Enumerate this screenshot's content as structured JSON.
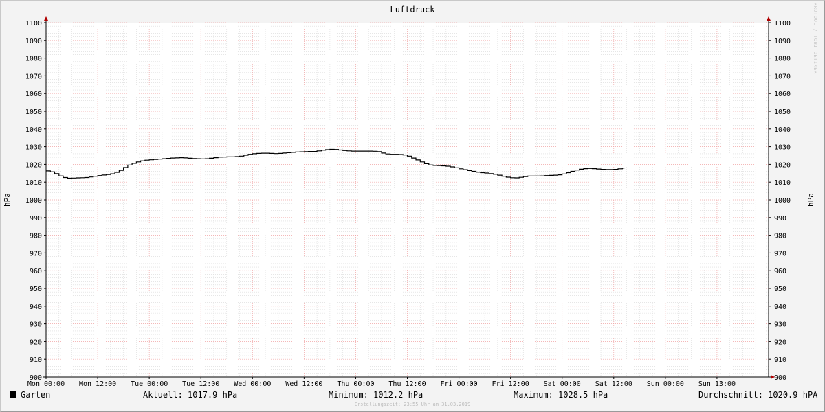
{
  "chart_data": {
    "type": "line",
    "title": "Luftdruck",
    "ylabel": "hPa",
    "ylabel_right": "hPa",
    "ylim": [
      900,
      1100
    ],
    "yticks": [
      900,
      910,
      920,
      930,
      940,
      950,
      960,
      970,
      980,
      990,
      1000,
      1010,
      1020,
      1030,
      1040,
      1050,
      1060,
      1070,
      1080,
      1090,
      1100
    ],
    "xticks": [
      {
        "h": 0,
        "label": "Mon 00:00"
      },
      {
        "h": 12,
        "label": "Mon 12:00"
      },
      {
        "h": 24,
        "label": "Tue 00:00"
      },
      {
        "h": 36,
        "label": "Tue 12:00"
      },
      {
        "h": 48,
        "label": "Wed 00:00"
      },
      {
        "h": 60,
        "label": "Wed 12:00"
      },
      {
        "h": 72,
        "label": "Thu 00:00"
      },
      {
        "h": 84,
        "label": "Thu 12:00"
      },
      {
        "h": 96,
        "label": "Fri 00:00"
      },
      {
        "h": 108,
        "label": "Fri 12:00"
      },
      {
        "h": 120,
        "label": "Sat 00:00"
      },
      {
        "h": 132,
        "label": "Sat 12:00"
      },
      {
        "h": 144,
        "label": "Sun 00:00"
      },
      {
        "h": 156,
        "label": "Sun 13:00"
      }
    ],
    "xlim": [
      0,
      168
    ],
    "grid": true,
    "series": [
      {
        "name": "Garten",
        "color": "#000000",
        "points": [
          [
            0,
            1016.3
          ],
          [
            1,
            1015.8
          ],
          [
            2,
            1014.8
          ],
          [
            3,
            1013.5
          ],
          [
            4,
            1012.6
          ],
          [
            5,
            1012.2
          ],
          [
            6,
            1012.3
          ],
          [
            7,
            1012.4
          ],
          [
            8,
            1012.5
          ],
          [
            9,
            1012.6
          ],
          [
            10,
            1012.9
          ],
          [
            11,
            1013.3
          ],
          [
            12,
            1013.7
          ],
          [
            13,
            1014.0
          ],
          [
            14,
            1014.3
          ],
          [
            15,
            1014.7
          ],
          [
            16,
            1015.5
          ],
          [
            17,
            1016.6
          ],
          [
            18,
            1018.2
          ],
          [
            19,
            1019.6
          ],
          [
            20,
            1020.6
          ],
          [
            21,
            1021.4
          ],
          [
            22,
            1022.0
          ],
          [
            23,
            1022.4
          ],
          [
            24,
            1022.6
          ],
          [
            25,
            1022.8
          ],
          [
            26,
            1023.0
          ],
          [
            27,
            1023.2
          ],
          [
            28,
            1023.4
          ],
          [
            29,
            1023.6
          ],
          [
            30,
            1023.7
          ],
          [
            31,
            1023.8
          ],
          [
            32,
            1023.7
          ],
          [
            33,
            1023.5
          ],
          [
            34,
            1023.3
          ],
          [
            35,
            1023.2
          ],
          [
            36,
            1023.1
          ],
          [
            37,
            1023.2
          ],
          [
            38,
            1023.5
          ],
          [
            39,
            1023.8
          ],
          [
            40,
            1024.1
          ],
          [
            41,
            1024.2
          ],
          [
            42,
            1024.3
          ],
          [
            43,
            1024.3
          ],
          [
            44,
            1024.4
          ],
          [
            45,
            1024.7
          ],
          [
            46,
            1025.2
          ],
          [
            47,
            1025.7
          ],
          [
            48,
            1026.0
          ],
          [
            49,
            1026.2
          ],
          [
            50,
            1026.3
          ],
          [
            51,
            1026.3
          ],
          [
            52,
            1026.2
          ],
          [
            53,
            1026.1
          ],
          [
            54,
            1026.2
          ],
          [
            55,
            1026.4
          ],
          [
            56,
            1026.6
          ],
          [
            57,
            1026.8
          ],
          [
            58,
            1027.0
          ],
          [
            59,
            1027.1
          ],
          [
            60,
            1027.2
          ],
          [
            61,
            1027.3
          ],
          [
            62,
            1027.3
          ],
          [
            63,
            1027.6
          ],
          [
            64,
            1028.0
          ],
          [
            65,
            1028.3
          ],
          [
            66,
            1028.5
          ],
          [
            67,
            1028.4
          ],
          [
            68,
            1028.1
          ],
          [
            69,
            1027.8
          ],
          [
            70,
            1027.6
          ],
          [
            71,
            1027.5
          ],
          [
            72,
            1027.5
          ],
          [
            73,
            1027.5
          ],
          [
            74,
            1027.5
          ],
          [
            75,
            1027.5
          ],
          [
            76,
            1027.4
          ],
          [
            77,
            1027.2
          ],
          [
            78,
            1026.4
          ],
          [
            79,
            1025.9
          ],
          [
            80,
            1025.7
          ],
          [
            81,
            1025.7
          ],
          [
            82,
            1025.6
          ],
          [
            83,
            1025.3
          ],
          [
            84,
            1024.7
          ],
          [
            85,
            1023.6
          ],
          [
            86,
            1022.5
          ],
          [
            87,
            1021.4
          ],
          [
            88,
            1020.4
          ],
          [
            89,
            1019.7
          ],
          [
            90,
            1019.4
          ],
          [
            91,
            1019.3
          ],
          [
            92,
            1019.2
          ],
          [
            93,
            1019.0
          ],
          [
            94,
            1018.6
          ],
          [
            95,
            1018.1
          ],
          [
            96,
            1017.5
          ],
          [
            97,
            1017.0
          ],
          [
            98,
            1016.5
          ],
          [
            99,
            1016.1
          ],
          [
            100,
            1015.6
          ],
          [
            101,
            1015.3
          ],
          [
            102,
            1015.1
          ],
          [
            103,
            1014.8
          ],
          [
            104,
            1014.4
          ],
          [
            105,
            1013.9
          ],
          [
            106,
            1013.3
          ],
          [
            107,
            1012.8
          ],
          [
            108,
            1012.5
          ],
          [
            109,
            1012.4
          ],
          [
            110,
            1012.7
          ],
          [
            111,
            1013.1
          ],
          [
            112,
            1013.4
          ],
          [
            113,
            1013.4
          ],
          [
            114,
            1013.4
          ],
          [
            115,
            1013.5
          ],
          [
            116,
            1013.7
          ],
          [
            117,
            1013.8
          ],
          [
            118,
            1013.9
          ],
          [
            119,
            1014.1
          ],
          [
            120,
            1014.6
          ],
          [
            121,
            1015.3
          ],
          [
            122,
            1016.1
          ],
          [
            123,
            1016.8
          ],
          [
            124,
            1017.3
          ],
          [
            125,
            1017.6
          ],
          [
            126,
            1017.7
          ],
          [
            127,
            1017.6
          ],
          [
            128,
            1017.4
          ],
          [
            129,
            1017.2
          ],
          [
            130,
            1017.1
          ],
          [
            131,
            1017.1
          ],
          [
            132,
            1017.2
          ],
          [
            133,
            1017.5
          ],
          [
            134,
            1017.9
          ]
        ]
      }
    ]
  },
  "legend": {
    "name": "Garten",
    "color": "#000000"
  },
  "stats": {
    "current": "Aktuell: 1017.9 hPa",
    "min": "Minimum: 1012.2 hPa",
    "max": "Maximum: 1028.5 hPa",
    "avg": "Durchschnitt: 1020.9 hPA"
  },
  "credit": "Erstellungszeit: 23:55 Uhr am 31.03.2019",
  "watermark": "RRDTOOL / TOBI OETIKER",
  "colors": {
    "grid_minor": "#d8d8d8",
    "grid_major": "#f0a0a0",
    "axis": "#000000",
    "arrow": "#b00000"
  }
}
